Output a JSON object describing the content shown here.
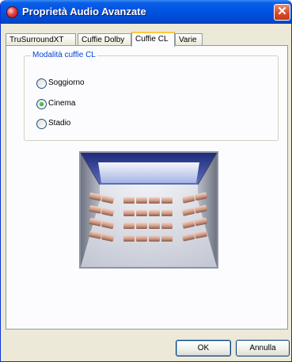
{
  "window": {
    "title": "Proprietà Audio Avanzate",
    "title_icon": "speaker-app-icon",
    "close_icon": "close-icon",
    "close_glyph": "✕"
  },
  "tabs": [
    {
      "label": "TruSurroundXT",
      "active": false
    },
    {
      "label": "Cuffie Dolby",
      "active": false
    },
    {
      "label": "Cuffie CL",
      "active": true
    },
    {
      "label": "Varie",
      "active": false
    }
  ],
  "group": {
    "legend": "Modalità cuffie CL",
    "options": [
      {
        "label": "Soggiorno",
        "selected": false
      },
      {
        "label": "Cinema",
        "selected": true
      },
      {
        "label": "Stadio",
        "selected": false
      }
    ]
  },
  "illustration": {
    "icon": "cinema-theater-illustration"
  },
  "buttons": {
    "ok": "OK",
    "cancel": "Annulla"
  },
  "colors": {
    "title_bar": "#0054e3",
    "close_button": "#d84c2a",
    "group_legend": "#0046d5",
    "active_tab_accent": "#ffc83c",
    "radio_selected": "#21a121"
  }
}
